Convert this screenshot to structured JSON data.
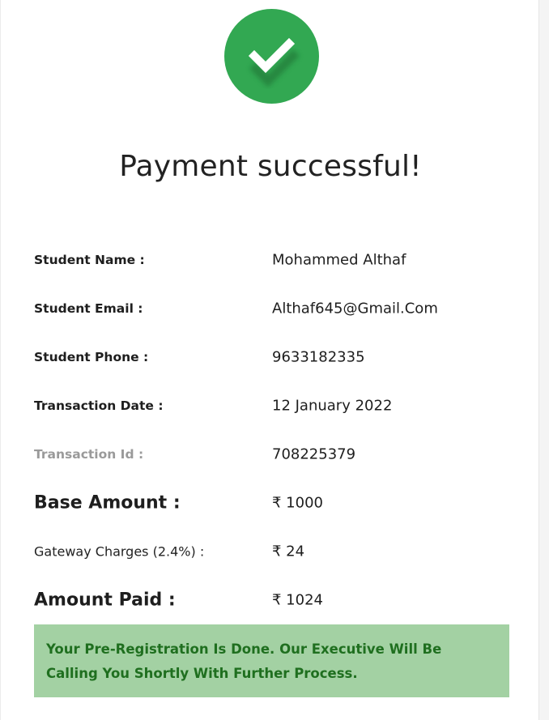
{
  "status": {
    "title": "Payment successful!",
    "icon": "check-icon",
    "icon_color": "#32a852"
  },
  "details": [
    {
      "label": "Student Name :",
      "value": "Mohammed Althaf"
    },
    {
      "label": "Student Email :",
      "value": "Althaf645@Gmail.Com"
    },
    {
      "label": "Student Phone :",
      "value": "9633182335"
    },
    {
      "label": "Transaction Date :",
      "value": "12 January 2022"
    },
    {
      "label": "Transaction Id :",
      "value": "708225379"
    },
    {
      "label": "Base Amount :",
      "value": "₹ 1000"
    },
    {
      "label": "Gateway Charges (2.4%) :",
      "value": "₹ 24"
    },
    {
      "label": "Amount Paid :",
      "value": "₹ 1024"
    }
  ],
  "notice": {
    "text": "Your Pre-Registration Is Done. Our Executive Will Be Calling You Shortly With Further Process.",
    "background": "#a3d1a3",
    "color": "#1f6f1f"
  }
}
